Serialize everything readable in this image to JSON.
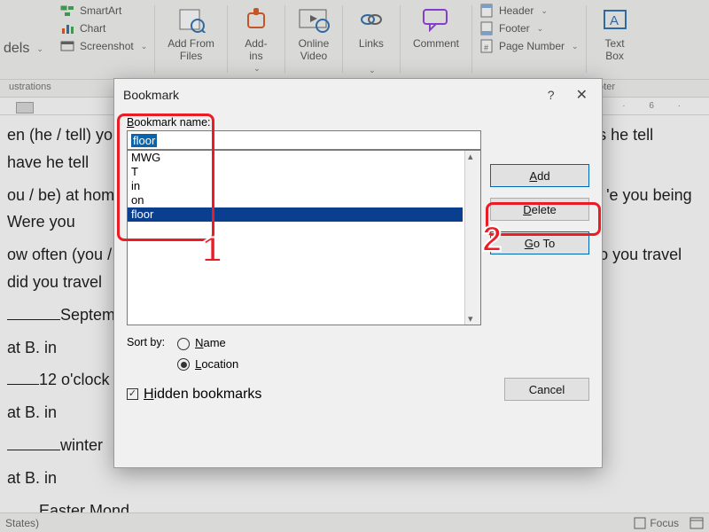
{
  "ribbon": {
    "models_label": "dels",
    "smartart": "SmartArt",
    "chart": "Chart",
    "screenshot": "Screenshot",
    "add_from_files": "Add From\nFiles",
    "addins": "Add-\nins",
    "online_video": "Online\nVideo",
    "links": "Links",
    "comment": "Comment",
    "header": "Header",
    "footer": "Footer",
    "page_number": "Page Number",
    "text_box": "Text\nBox",
    "group_illustrations": "ustrations",
    "group_hf_cut": "ooter"
  },
  "ruler_right": "· 6 ·",
  "doc": {
    "l1a": "en (he / tell) yo",
    "l1b": "s he tell",
    "l2": "have he tell",
    "l3a": "ou / be) at home ",
    "l3b": "'e you being",
    "l4": "Were you",
    "l5a": "ow often (you / t",
    "l5b": "o you travel",
    "l6": "did you travel",
    "l7": "September",
    "l8": "at            B. in",
    "l9": "12 o'clock",
    "l10": "at            B. in",
    "l11": "winter",
    "l12": "at            B. in",
    "l13": "Easter Mond"
  },
  "dialog": {
    "title": "Bookmark",
    "help": "?",
    "name_label_pre": "B",
    "name_label_post": "ookmark name:",
    "name_value": "floor",
    "list": [
      "MWG",
      "T",
      "in",
      "on",
      "floor"
    ],
    "selected_index": 4,
    "add": "Add",
    "delete": "Delete",
    "goto": "Go To",
    "sortby": "Sort by:",
    "sort_name": "Name",
    "sort_location": "Location",
    "hidden": "Hidden bookmarks",
    "cancel": "Cancel"
  },
  "status": {
    "left": "States)",
    "focus": "Focus"
  },
  "callouts": {
    "one": "1",
    "two": "2"
  }
}
